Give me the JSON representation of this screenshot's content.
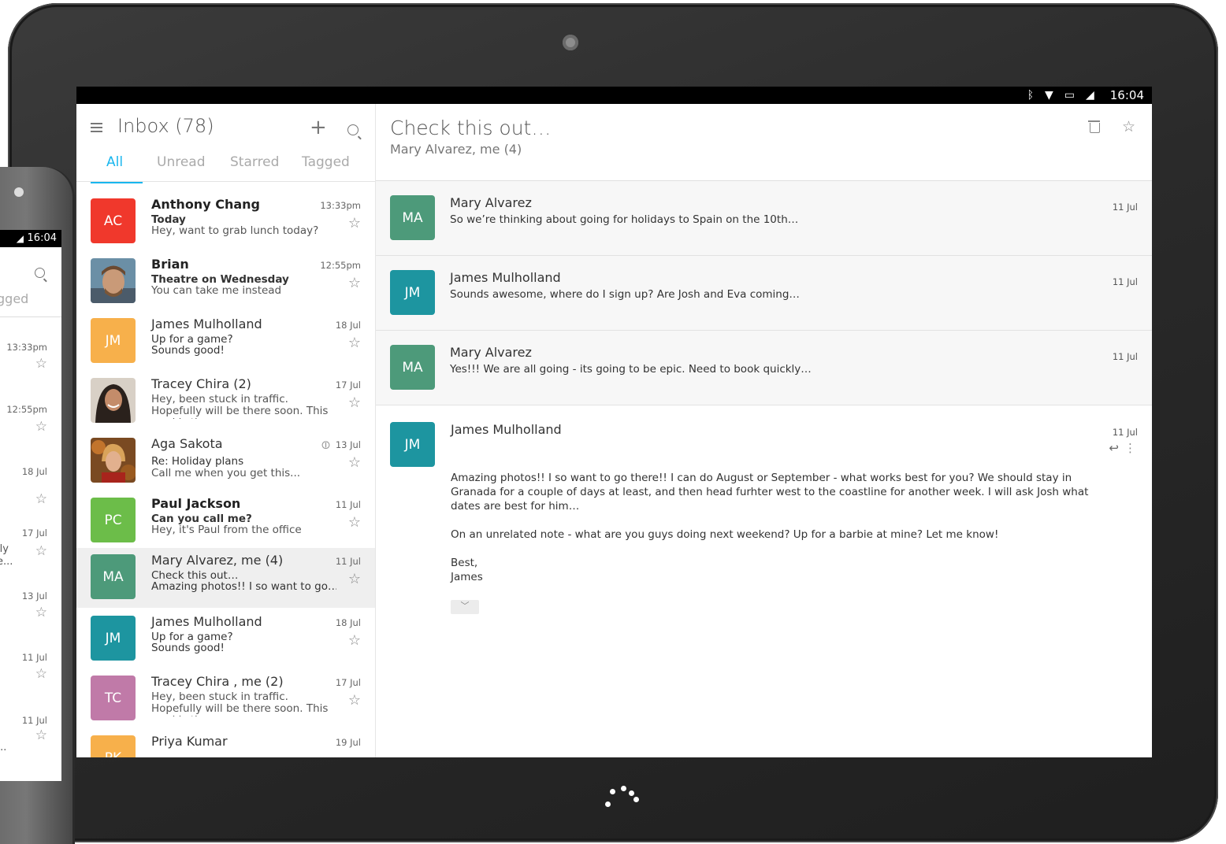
{
  "status_bar": {
    "time": "16:04"
  },
  "inbox": {
    "title": "Inbox (78)",
    "tabs": [
      "All",
      "Unread",
      "Starred",
      "Tagged"
    ],
    "active_tab": "All"
  },
  "colors": {
    "accent": "#19b6ee"
  },
  "icons": [
    "menu-icon",
    "add-icon",
    "search-icon",
    "star-icon",
    "attachment-icon",
    "trash-icon",
    "unstar-icon",
    "reply-icon",
    "more-icon",
    "expand-icon"
  ],
  "conversations": [
    {
      "initials": "AC",
      "color": "#f0382c",
      "name": "Anthony Chang",
      "subject": "Today",
      "preview": "Hey, want to grab lunch today?",
      "time": "13:33pm",
      "unread": true
    },
    {
      "initials": "",
      "color": "#8a6f55",
      "name": "Brian",
      "subject": "Theatre on Wednesday",
      "preview": "You can take me instead",
      "time": "12:55pm",
      "unread": true
    },
    {
      "initials": "JM",
      "color": "#f7b04b",
      "name": "James Mulholland",
      "subject": "Up for a game?",
      "preview": "Sounds good!",
      "time": "18 Jul",
      "unread": false
    },
    {
      "initials": "",
      "color": "#3e3530",
      "name": "Tracey Chira (2)",
      "subject": "",
      "preview": "Hey, been stuck in traffic. Hopefully will be there soon. This road is the...",
      "time": "17 Jul",
      "unread": false
    },
    {
      "initials": "",
      "color": "#b0582a",
      "name": "Aga Sakota",
      "subject": "Re: Holiday plans",
      "preview": "Call me when you get this...",
      "time": "13 Jul",
      "unread": false,
      "attachment": true
    },
    {
      "initials": "PC",
      "color": "#6cbd49",
      "name": "Paul Jackson",
      "subject": "Can you call me?",
      "preview": "Hey, it's Paul from the office",
      "time": "11 Jul",
      "unread": true
    },
    {
      "initials": "MA",
      "color": "#4d9a7a",
      "name": "Mary Alvarez, me (4)",
      "subject": "Check this out…",
      "preview": "Amazing photos!! I so want to go…",
      "time": "11 Jul",
      "unread": false,
      "selected": true
    },
    {
      "initials": "JM",
      "color": "#1d95a0",
      "name": "James Mulholland",
      "subject": "Up for a game?",
      "preview": "Sounds good!",
      "time": "18 Jul",
      "unread": false
    },
    {
      "initials": "TC",
      "color": "#c07aa8",
      "name": "Tracey Chira , me (2)",
      "subject": "",
      "preview": "Hey, been stuck in traffic. Hopefully will be there soon. This road is the...",
      "time": "17 Jul",
      "unread": false
    },
    {
      "initials": "PK",
      "color": "#f7b04b",
      "name": "Priya Kumar",
      "subject": "",
      "preview": "",
      "time": "19 Jul",
      "unread": false
    }
  ],
  "thread": {
    "title": "Check this out…",
    "participants": "Mary Alvarez, me (4)",
    "messages": [
      {
        "initials": "MA",
        "color": "#4d9a7a",
        "from": "Mary Alvarez",
        "snippet": "So we’re thinking about going for holidays to Spain on the 10th…",
        "date": "11 Jul"
      },
      {
        "initials": "JM",
        "color": "#1d95a0",
        "from": "James Mulholland",
        "snippet": "Sounds awesome, where do I sign up? Are Josh and Eva coming…",
        "date": "11 Jul"
      },
      {
        "initials": "MA",
        "color": "#4d9a7a",
        "from": "Mary Alvarez",
        "snippet": "Yes!!! We are all going - its going to be epic. Need to book quickly…",
        "date": "11 Jul"
      }
    ],
    "open_message": {
      "initials": "JM",
      "color": "#1d95a0",
      "from": "James Mulholland",
      "date": "11 Jul",
      "body_1": "Amazing photos!! I so want to go there!! I can do  August or September - what works best for you? We should stay in Granada for a couple of days at least, and then head  furhter west to the coastline for another week. I will ask Josh what dates are best for him…",
      "body_2": "On an unrelated note - what are you guys doing next weekend? Up for a barbie at mine? Let me know!",
      "signoff": "Best,",
      "signature": "James"
    }
  },
  "phone": {
    "time": "16:04",
    "tab_fragment": "gged",
    "items": [
      {
        "time": "13:33pm"
      },
      {
        "time": "12:55pm"
      },
      {
        "time": "18 Jul"
      },
      {
        "time": "17 Jul",
        "fragment_1": "lly",
        "fragment_2": "e..."
      },
      {
        "time": "13 Jul"
      },
      {
        "time": "11 Jul"
      },
      {
        "time": "11 Jul",
        "fragment_1": "..."
      }
    ]
  }
}
